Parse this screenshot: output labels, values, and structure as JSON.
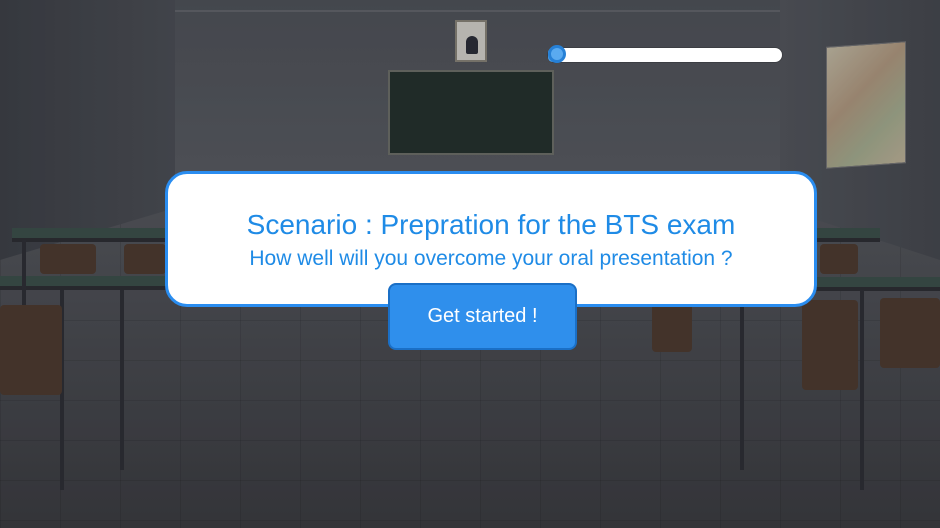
{
  "progress": {
    "value": 0.0
  },
  "dialog": {
    "title": "Scenario : Prepration for the BTS exam",
    "subtitle": "How well will you overcome your oral presentation ?"
  },
  "actions": {
    "start_label": "Get started !"
  },
  "colors": {
    "accent": "#2a8df0",
    "text_accent": "#1f8be6",
    "button": "#2f8fec",
    "dialog_bg": "#ffffff"
  }
}
